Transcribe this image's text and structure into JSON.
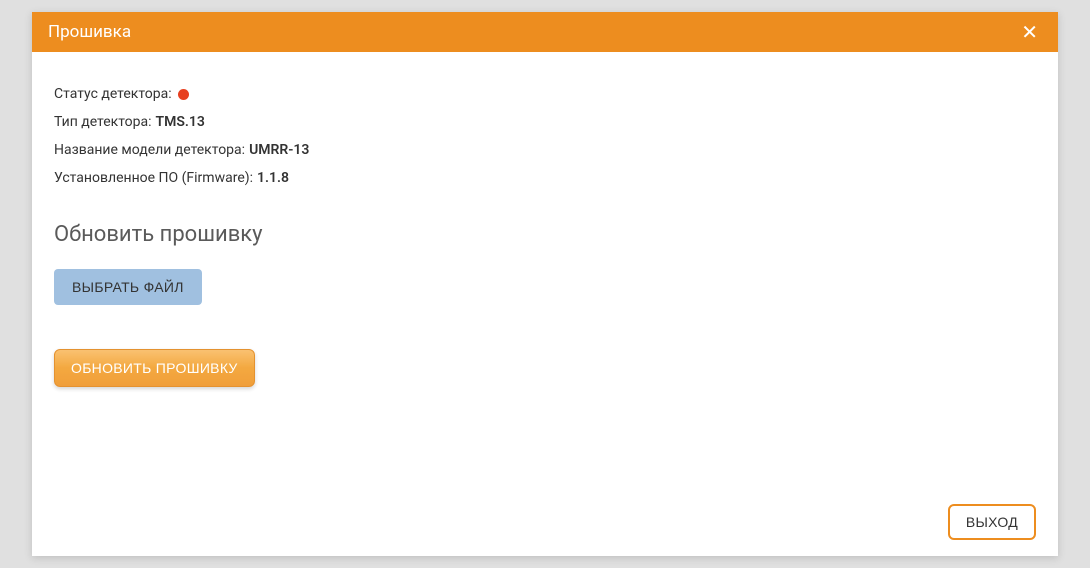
{
  "header": {
    "title": "Прошивка"
  },
  "info": {
    "status_label": "Статус детектора:",
    "status_color": "#e74020",
    "type_label": "Тип детектора:",
    "type_value": "TMS.13",
    "model_label": "Название модели детектора:",
    "model_value": "UMRR-13",
    "firmware_label": "Установленное ПО (Firmware):",
    "firmware_value": "1.1.8"
  },
  "update": {
    "section_title": "Обновить прошивку",
    "choose_file_label": "ВЫБРАТЬ ФАЙЛ",
    "update_button_label": "ОБНОВИТЬ ПРОШИВКУ"
  },
  "footer": {
    "exit_label": "ВЫХОД"
  }
}
